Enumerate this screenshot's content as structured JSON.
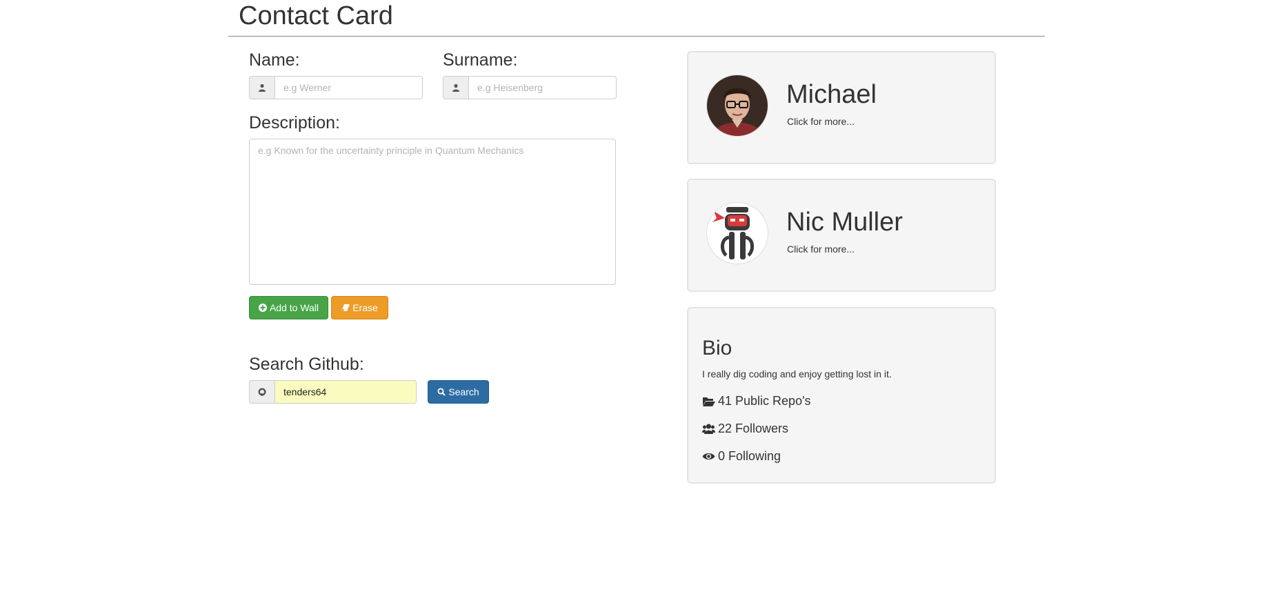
{
  "page": {
    "title": "Contact Card"
  },
  "form": {
    "name_label": "Name:",
    "name_placeholder": "e.g Werner",
    "surname_label": "Surname:",
    "surname_placeholder": "e.g Heisenberg",
    "description_label": "Description:",
    "description_placeholder": "e.g Known for the uncertainty principle in Quantum Mechanics",
    "add_label": "Add to Wall",
    "erase_label": "Erase"
  },
  "github": {
    "label": "Search Github:",
    "value": "tenders64",
    "search_label": "Search"
  },
  "contacts": [
    {
      "name": "Michael",
      "more": "Click for more..."
    },
    {
      "name": "Nic Muller",
      "more": "Click for more..."
    }
  ],
  "bio": {
    "title": "Bio",
    "text": "I really dig coding and enjoy getting lost in it.",
    "repos": "41 Public Repo's",
    "followers": "22 Followers",
    "following": "0 Following"
  },
  "icons": {
    "name": "user-icon",
    "surname": "user-icon",
    "github": "github-icon",
    "add": "plus-circle-icon",
    "erase": "eraser-icon",
    "search": "search-icon",
    "repos": "folder-open-icon",
    "followers": "users-icon",
    "following": "eye-icon"
  },
  "colors": {
    "add_button": "#47a447",
    "erase_button": "#ed9c28",
    "search_button": "#2d6ca2",
    "github_input_bg": "#fafcbf",
    "card_bg": "#f5f5f5"
  }
}
